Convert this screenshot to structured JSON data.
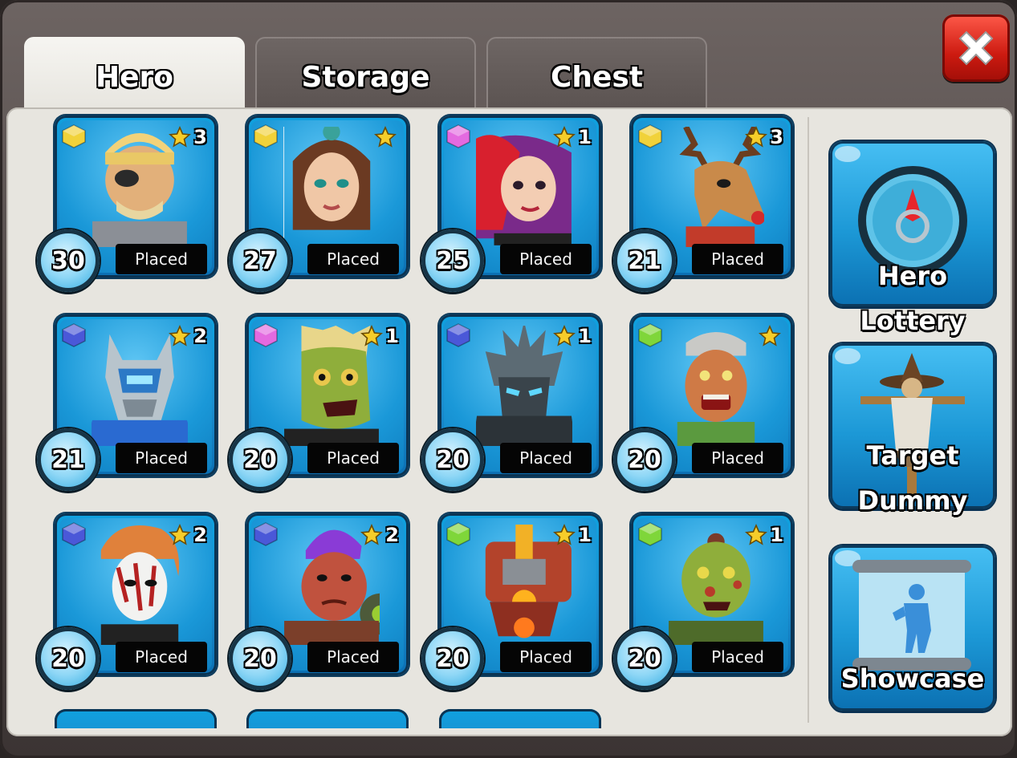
{
  "tabs": [
    {
      "label": "Hero",
      "active": true
    },
    {
      "label": "Storage",
      "active": false
    },
    {
      "label": "Chest",
      "active": false
    }
  ],
  "close_button": {
    "icon": "close-x-icon"
  },
  "heroes": [
    {
      "level": "30",
      "stars": "3",
      "status": "Placed",
      "gem_color": "#f1d23a",
      "portrait": "eyepatch-warrior"
    },
    {
      "level": "27",
      "stars": "",
      "status": "Placed",
      "gem_color": "#f1d23a",
      "portrait": "brunette-swordswoman"
    },
    {
      "level": "25",
      "stars": "1",
      "status": "Placed",
      "gem_color": "#e46ae0",
      "portrait": "red-purple-haired-girl"
    },
    {
      "level": "21",
      "stars": "3",
      "status": "Placed",
      "gem_color": "#f1d23a",
      "portrait": "reindeer"
    },
    {
      "level": "21",
      "stars": "2",
      "status": "Placed",
      "gem_color": "#4a58d8",
      "portrait": "silver-robot-wolf"
    },
    {
      "level": "20",
      "stars": "1",
      "status": "Placed",
      "gem_color": "#e46ae0",
      "portrait": "blonde-zombie"
    },
    {
      "level": "20",
      "stars": "1",
      "status": "Placed",
      "gem_color": "#4a58d8",
      "portrait": "dark-knight"
    },
    {
      "level": "20",
      "stars": "",
      "status": "Placed",
      "gem_color": "#7fd63a",
      "portrait": "old-zombie"
    },
    {
      "level": "20",
      "stars": "2",
      "status": "Placed",
      "gem_color": "#4a58d8",
      "portrait": "masked-orange-hair"
    },
    {
      "level": "20",
      "stars": "2",
      "status": "Placed",
      "gem_color": "#4a58d8",
      "portrait": "purple-mohawk-brute"
    },
    {
      "level": "20",
      "stars": "1",
      "status": "Placed",
      "gem_color": "#7fd63a",
      "portrait": "red-mech-robot"
    },
    {
      "level": "20",
      "stars": "1",
      "status": "Placed",
      "gem_color": "#7fd63a",
      "portrait": "green-orc-zombie"
    }
  ],
  "sidebar": {
    "lottery": {
      "label": "Hero Lottery",
      "icon": "compass-icon"
    },
    "dummy": {
      "label1": "Target",
      "label2": "Dummy",
      "icon": "scarecrow-icon"
    },
    "showcase": {
      "label": "Showcase",
      "icon": "scroll-blueprint-icon"
    }
  }
}
